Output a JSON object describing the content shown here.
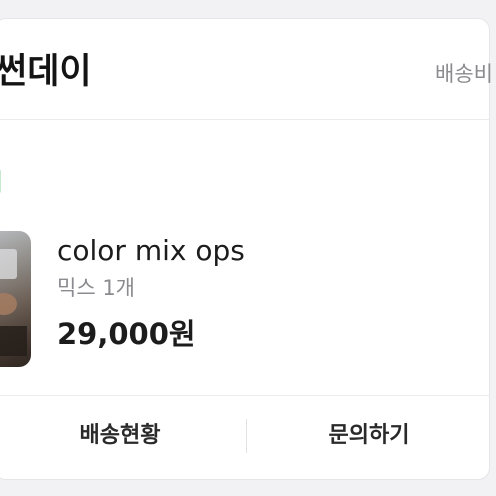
{
  "order": {
    "shop_name": "썬데이",
    "shipping_fee_label": "배송비",
    "status_glyph": "ㅣ",
    "status_color": "#3cb05a"
  },
  "product": {
    "name": "color mix ops",
    "option": "믹스 1개",
    "price": "29,000원",
    "thumbnail_icon": "product-photo"
  },
  "actions": {
    "track_label": "배송현황",
    "inquiry_label": "문의하기"
  }
}
